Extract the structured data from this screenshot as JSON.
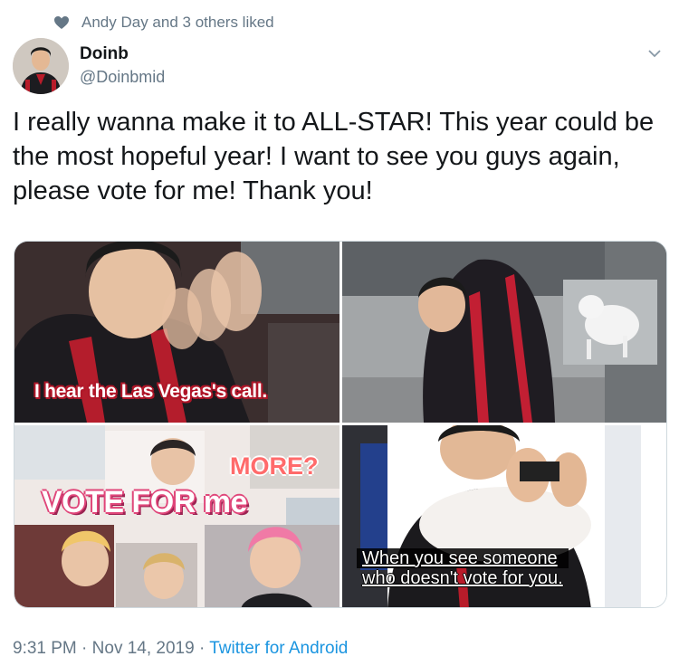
{
  "social_context": {
    "text": "Andy Day and 3 others liked",
    "icon": "heart-icon"
  },
  "author": {
    "display_name": "Doinb",
    "handle": "@Doinbmid"
  },
  "tweet": {
    "text": "I really wanna make it to ALL-STAR! This year could be the most hopeful year! I want to see you guys again, please vote for me! Thank you!"
  },
  "media": {
    "captions": {
      "image1": "I hear the Las Vegas's call.",
      "image3_more": "MORE?",
      "image3_vote": "VOTE FOR me",
      "image4_line1": "When you see someone",
      "image4_line2": "who doesn't vote for you."
    }
  },
  "meta": {
    "time": "9:31 PM",
    "date": "Nov 14, 2019",
    "source": "Twitter for Android",
    "separator": "·"
  },
  "colors": {
    "link": "#1b95e0",
    "secondary_text": "#657786"
  }
}
